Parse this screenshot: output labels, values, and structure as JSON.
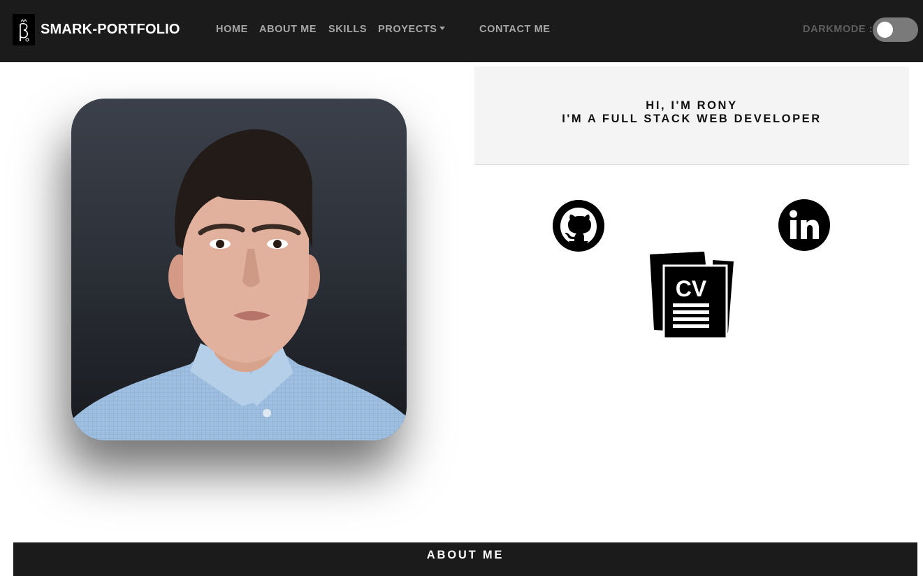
{
  "navbar": {
    "brand": "SMARK-PORTFOLIO",
    "links": [
      {
        "label": "HOME"
      },
      {
        "label": "ABOUT ME"
      },
      {
        "label": "SKILLS"
      },
      {
        "label": "PROYECTS"
      },
      {
        "label": "CONTACT ME"
      }
    ],
    "darkmode_label": "DARKMODE :",
    "darkmode_on": false
  },
  "hero": {
    "greeting_line1": "HI, I'M RONY",
    "greeting_line2": "I'M A FULL STACK WEB DEVELOPER",
    "social": {
      "github_icon": "github-icon",
      "linkedin_icon": "linkedin-icon",
      "cv_icon": "cv-document-icon",
      "cv_text": "CV"
    }
  },
  "about": {
    "title": "ABOUT ME"
  },
  "colors": {
    "navbar_bg": "#1b1b1b",
    "nav_link": "#a7a7a7",
    "greeting_bg": "#f4f4f4"
  }
}
